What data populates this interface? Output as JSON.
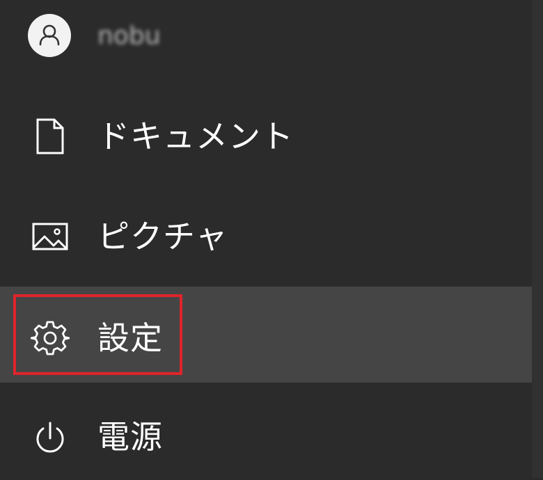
{
  "user": {
    "name": "nobu"
  },
  "menu_items": [
    {
      "label": "ドキュメント",
      "icon": "document-icon"
    },
    {
      "label": "ピクチャ",
      "icon": "pictures-icon"
    },
    {
      "label": "設定",
      "icon": "gear-icon"
    },
    {
      "label": "電源",
      "icon": "power-icon"
    }
  ],
  "colors": {
    "background": "#2b2b2b",
    "hover_background": "#454545",
    "highlight_border": "#e0242b",
    "text": "#ffffff"
  }
}
